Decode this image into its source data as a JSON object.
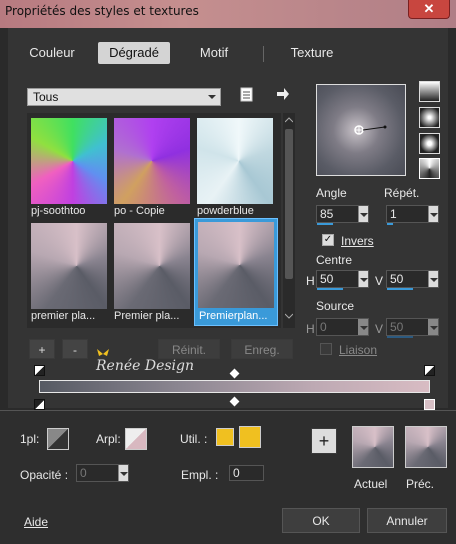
{
  "window": {
    "title": "Propriétés des styles et textures",
    "close": "✕"
  },
  "tabs": [
    {
      "label": "Couleur",
      "active": false
    },
    {
      "label": "Dégradé",
      "active": true
    },
    {
      "label": "Motif",
      "active": false
    },
    {
      "label": "Texture",
      "active": false
    }
  ],
  "category": {
    "selected": "Tous"
  },
  "swatches": [
    {
      "label": "pj-soothtoo",
      "selected": false
    },
    {
      "label": "po - Copie",
      "selected": false
    },
    {
      "label": "powderblue",
      "selected": false
    },
    {
      "label": "premier pla...",
      "selected": false
    },
    {
      "label": "Premier pla...",
      "selected": false
    },
    {
      "label": "Premierplan...",
      "selected": true
    }
  ],
  "list_buttons": {
    "add": "+",
    "remove": "-",
    "reset": "Réinit.",
    "save": "Enreg."
  },
  "gradient": {
    "angle_label": "Angle",
    "angle_value": "85",
    "repeat_label": "Répét.",
    "repeat_value": "1",
    "invert_label": "Invers",
    "invert_checked": true,
    "center_label": "Centre",
    "center_h": "50",
    "center_v": "50",
    "source_label": "Source",
    "source_h": "0",
    "source_v": "50",
    "link_label": "Liaison",
    "link_checked": false,
    "h_label": "H",
    "v_label": "V"
  },
  "watermark": "Renée Design",
  "editor": {
    "fg_label": "1pl:",
    "bg_label": "Arpl:",
    "util_label": "Util. :",
    "opacity_label": "Opacité :",
    "opacity_value": "0",
    "location_label": "Empl. :",
    "location_value": "0",
    "util_color": "#f0c020"
  },
  "previews": {
    "add": "+",
    "current_label": "Actuel",
    "previous_label": "Préc."
  },
  "dialog": {
    "help": "Aide",
    "ok": "OK",
    "cancel": "Annuler"
  },
  "colors": {
    "accent": "#3a9ad9",
    "title_bar": "#c08a8e"
  }
}
